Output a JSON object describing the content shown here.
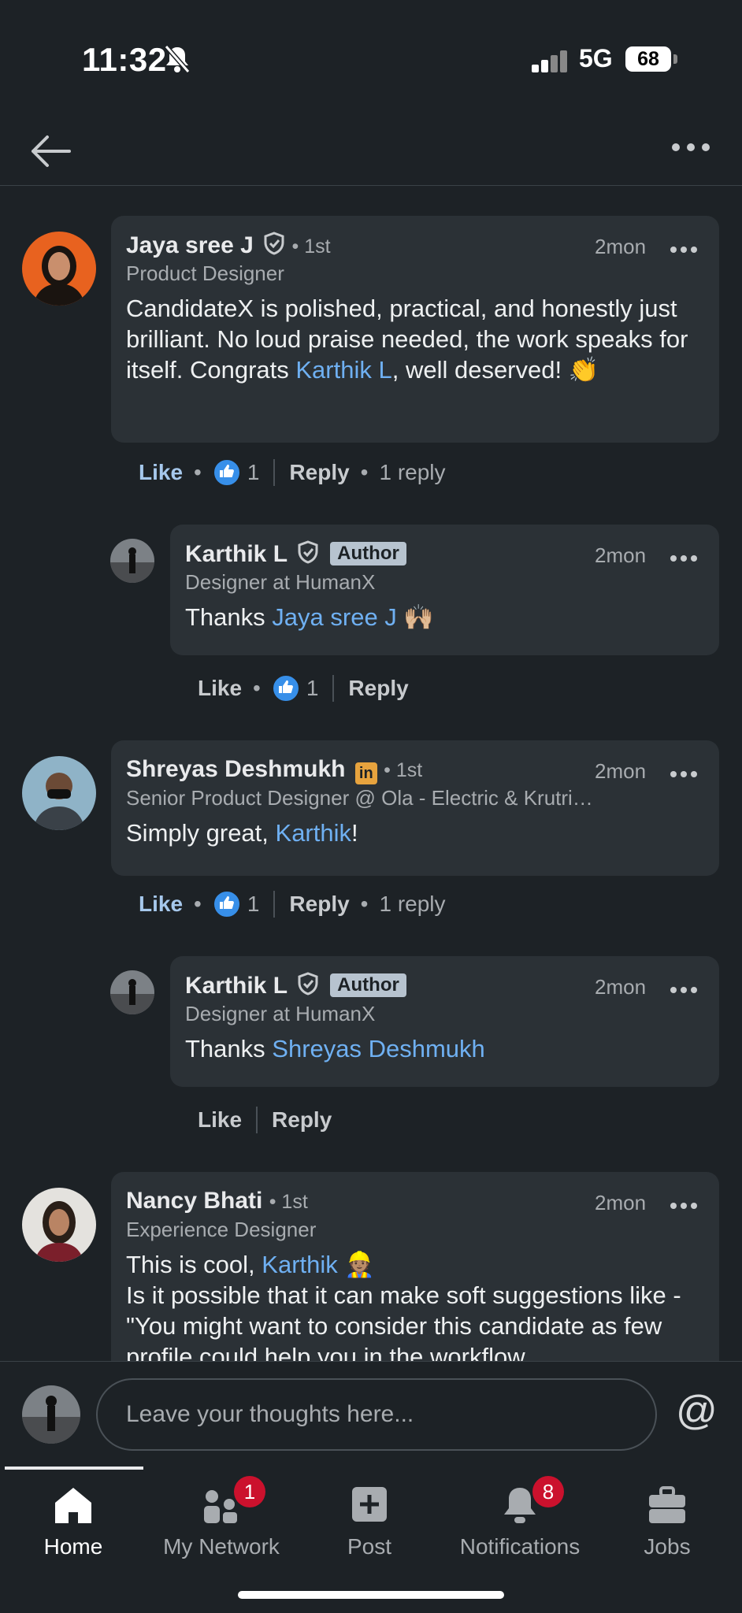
{
  "status_bar": {
    "time": "11:32",
    "network": "5G",
    "battery": "68"
  },
  "comments": [
    {
      "name": "Jaya sree J",
      "degree": "• 1st",
      "subtitle": "Product Designer",
      "time": "2mon",
      "body_before": "CandidateX is polished, practical, and honestly just brilliant. No loud praise needed, the work speaks for itself. Congrats ",
      "mention": "Karthik L",
      "body_after": ", well deserved! 👏",
      "like_label": "Like",
      "reaction_count": "1",
      "reply_label": "Reply",
      "replies_label": "1 reply",
      "reply": {
        "name": "Karthik L",
        "badge": "Author",
        "subtitle": "Designer at HumanX",
        "time": "2mon",
        "body_before": "Thanks ",
        "mention": "Jaya sree J",
        "body_after": " 🙌🏼",
        "like_label": "Like",
        "reaction_count": "1",
        "reply_label": "Reply"
      }
    },
    {
      "name": "Shreyas Deshmukh",
      "degree": "• 1st",
      "subtitle": "Senior Product Designer @ Ola - Electric & Krutri…",
      "time": "2mon",
      "body_before": "Simply great, ",
      "mention": "Karthik",
      "body_after": "!",
      "like_label": "Like",
      "reaction_count": "1",
      "reply_label": "Reply",
      "replies_label": "1 reply",
      "reply": {
        "name": "Karthik L",
        "badge": "Author",
        "subtitle": "Designer at HumanX",
        "time": "2mon",
        "body_before": "Thanks ",
        "mention": "Shreyas Deshmukh",
        "body_after": "",
        "like_label": "Like",
        "reply_label": "Reply"
      }
    },
    {
      "name": "Nancy Bhati",
      "degree": "• 1st",
      "subtitle": "Experience Designer",
      "time": "2mon",
      "body_before": "This is cool, ",
      "mention": "Karthik",
      "body_after": " 👷🏽",
      "body_line2": "Is it possible that it can make soft suggestions like - \"You might want to consider this",
      "body_line3": "candidate as few profile could help you in the workflow"
    }
  ],
  "composer": {
    "placeholder": "Leave your thoughts here..."
  },
  "nav": [
    {
      "label": "Home",
      "icon": "home-icon"
    },
    {
      "label": "My Network",
      "icon": "network-icon",
      "badge": "1"
    },
    {
      "label": "Post",
      "icon": "post-icon"
    },
    {
      "label": "Notifications",
      "icon": "bell-icon",
      "badge": "8"
    },
    {
      "label": "Jobs",
      "icon": "briefcase-icon"
    }
  ]
}
